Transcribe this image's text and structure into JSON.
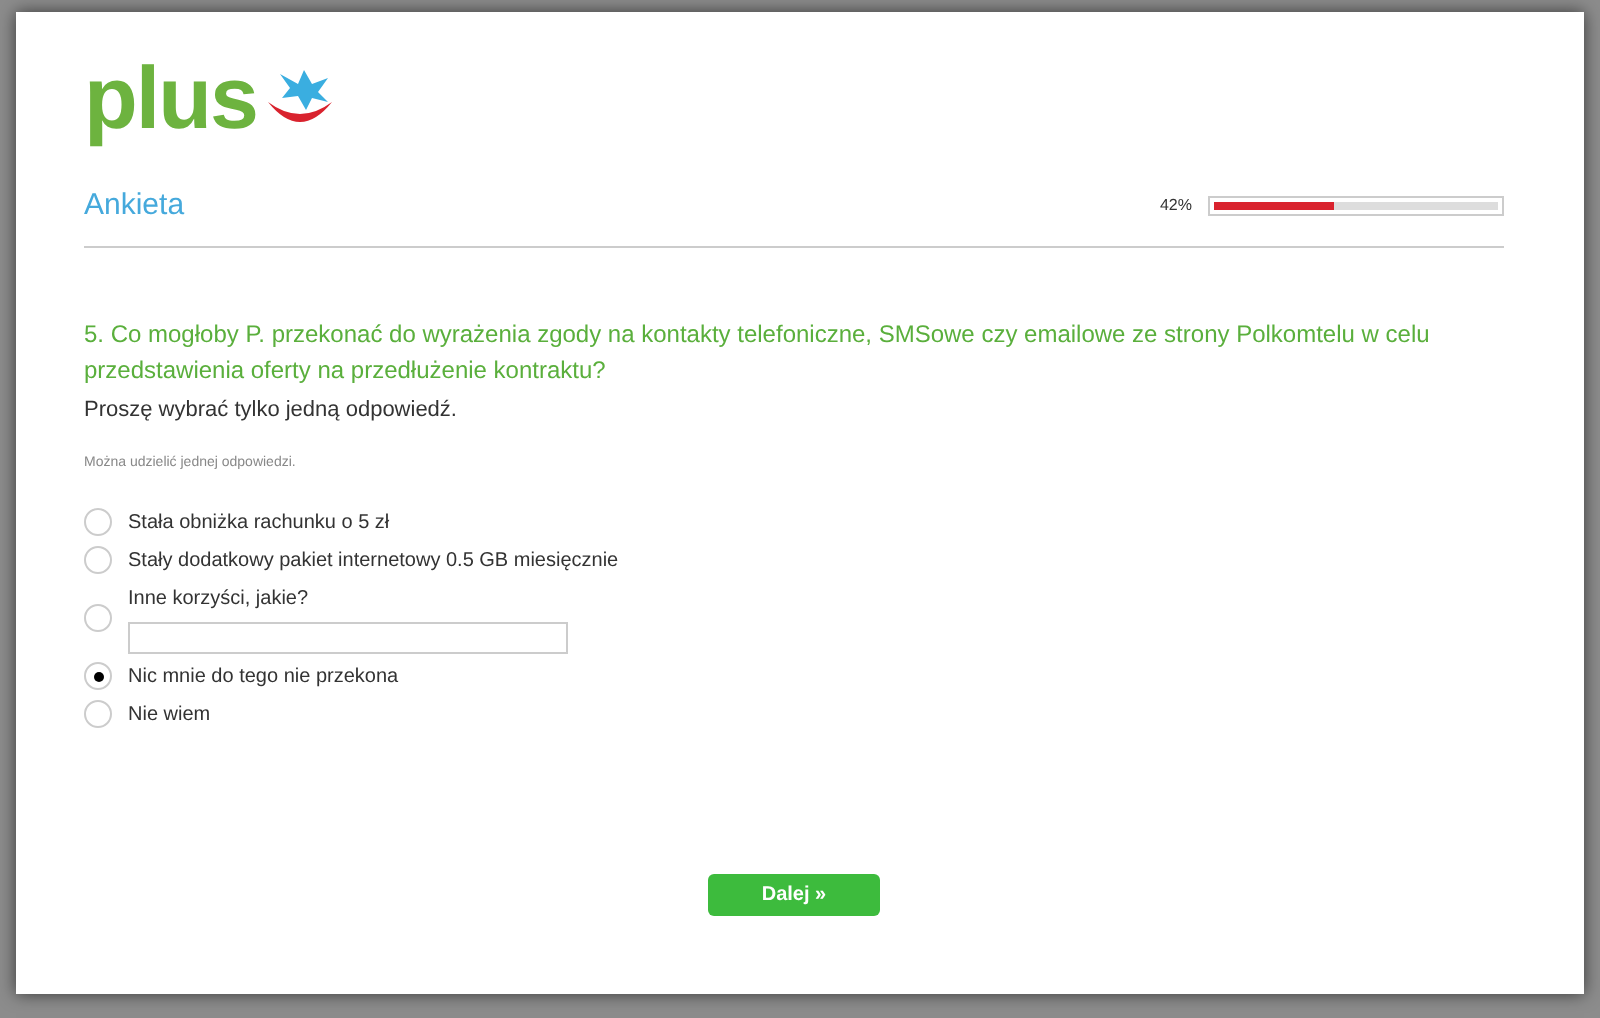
{
  "logo": {
    "text": "plus"
  },
  "header": {
    "title": "Ankieta",
    "progress": {
      "reading": "42%",
      "level": 0.42
    }
  },
  "question": {
    "text": "5. Co mogłoby P. przekonać do wyrażenia zgody na kontakty telefoniczne, SMSowe czy emailowe ze strony Polkomtelu w celu przedstawienia oferty na przedłużenie kontraktu?",
    "instruction": "Proszę wybrać tylko jedną odpowiedź.",
    "hint": "Można udzielić jednej odpowiedzi."
  },
  "options": [
    {
      "kind": "plain",
      "label": "Stała obniżka rachunku o 5 zł",
      "selected": false
    },
    {
      "kind": "plain",
      "label": "Stały dodatkowy pakiet internetowy 0.5 GB miesięcznie",
      "selected": false
    },
    {
      "kind": "text",
      "label": "Inne korzyści, jakie?",
      "selected": false
    },
    {
      "kind": "plain",
      "label": "Nic mnie do tego nie przekona",
      "selected": true
    },
    {
      "kind": "plain",
      "label": "Nie wiem",
      "selected": false
    }
  ],
  "next_button": {
    "label": "Dalej »"
  }
}
